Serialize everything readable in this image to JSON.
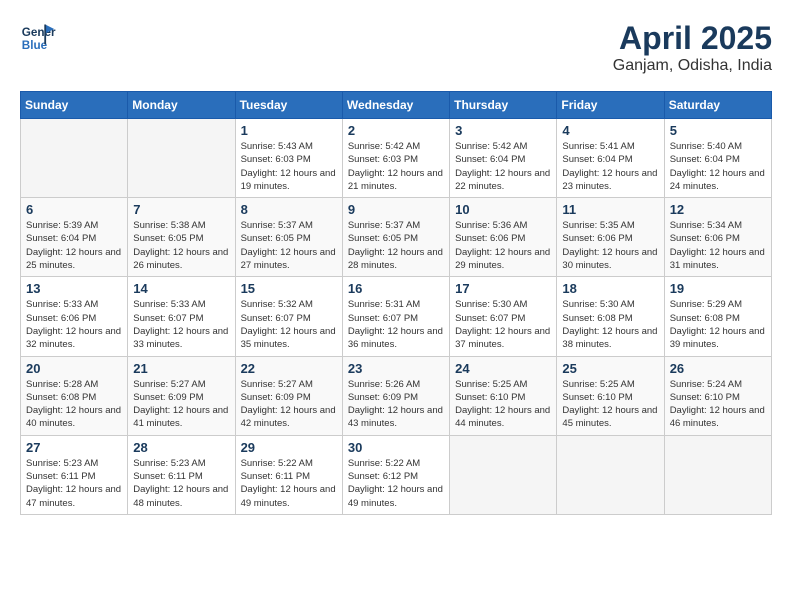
{
  "header": {
    "logo_line1": "General",
    "logo_line2": "Blue",
    "title": "April 2025",
    "location": "Ganjam, Odisha, India"
  },
  "days_of_week": [
    "Sunday",
    "Monday",
    "Tuesday",
    "Wednesday",
    "Thursday",
    "Friday",
    "Saturday"
  ],
  "weeks": [
    [
      {
        "day": "",
        "info": ""
      },
      {
        "day": "",
        "info": ""
      },
      {
        "day": "1",
        "info": "Sunrise: 5:43 AM\nSunset: 6:03 PM\nDaylight: 12 hours and 19 minutes."
      },
      {
        "day": "2",
        "info": "Sunrise: 5:42 AM\nSunset: 6:03 PM\nDaylight: 12 hours and 21 minutes."
      },
      {
        "day": "3",
        "info": "Sunrise: 5:42 AM\nSunset: 6:04 PM\nDaylight: 12 hours and 22 minutes."
      },
      {
        "day": "4",
        "info": "Sunrise: 5:41 AM\nSunset: 6:04 PM\nDaylight: 12 hours and 23 minutes."
      },
      {
        "day": "5",
        "info": "Sunrise: 5:40 AM\nSunset: 6:04 PM\nDaylight: 12 hours and 24 minutes."
      }
    ],
    [
      {
        "day": "6",
        "info": "Sunrise: 5:39 AM\nSunset: 6:04 PM\nDaylight: 12 hours and 25 minutes."
      },
      {
        "day": "7",
        "info": "Sunrise: 5:38 AM\nSunset: 6:05 PM\nDaylight: 12 hours and 26 minutes."
      },
      {
        "day": "8",
        "info": "Sunrise: 5:37 AM\nSunset: 6:05 PM\nDaylight: 12 hours and 27 minutes."
      },
      {
        "day": "9",
        "info": "Sunrise: 5:37 AM\nSunset: 6:05 PM\nDaylight: 12 hours and 28 minutes."
      },
      {
        "day": "10",
        "info": "Sunrise: 5:36 AM\nSunset: 6:06 PM\nDaylight: 12 hours and 29 minutes."
      },
      {
        "day": "11",
        "info": "Sunrise: 5:35 AM\nSunset: 6:06 PM\nDaylight: 12 hours and 30 minutes."
      },
      {
        "day": "12",
        "info": "Sunrise: 5:34 AM\nSunset: 6:06 PM\nDaylight: 12 hours and 31 minutes."
      }
    ],
    [
      {
        "day": "13",
        "info": "Sunrise: 5:33 AM\nSunset: 6:06 PM\nDaylight: 12 hours and 32 minutes."
      },
      {
        "day": "14",
        "info": "Sunrise: 5:33 AM\nSunset: 6:07 PM\nDaylight: 12 hours and 33 minutes."
      },
      {
        "day": "15",
        "info": "Sunrise: 5:32 AM\nSunset: 6:07 PM\nDaylight: 12 hours and 35 minutes."
      },
      {
        "day": "16",
        "info": "Sunrise: 5:31 AM\nSunset: 6:07 PM\nDaylight: 12 hours and 36 minutes."
      },
      {
        "day": "17",
        "info": "Sunrise: 5:30 AM\nSunset: 6:07 PM\nDaylight: 12 hours and 37 minutes."
      },
      {
        "day": "18",
        "info": "Sunrise: 5:30 AM\nSunset: 6:08 PM\nDaylight: 12 hours and 38 minutes."
      },
      {
        "day": "19",
        "info": "Sunrise: 5:29 AM\nSunset: 6:08 PM\nDaylight: 12 hours and 39 minutes."
      }
    ],
    [
      {
        "day": "20",
        "info": "Sunrise: 5:28 AM\nSunset: 6:08 PM\nDaylight: 12 hours and 40 minutes."
      },
      {
        "day": "21",
        "info": "Sunrise: 5:27 AM\nSunset: 6:09 PM\nDaylight: 12 hours and 41 minutes."
      },
      {
        "day": "22",
        "info": "Sunrise: 5:27 AM\nSunset: 6:09 PM\nDaylight: 12 hours and 42 minutes."
      },
      {
        "day": "23",
        "info": "Sunrise: 5:26 AM\nSunset: 6:09 PM\nDaylight: 12 hours and 43 minutes."
      },
      {
        "day": "24",
        "info": "Sunrise: 5:25 AM\nSunset: 6:10 PM\nDaylight: 12 hours and 44 minutes."
      },
      {
        "day": "25",
        "info": "Sunrise: 5:25 AM\nSunset: 6:10 PM\nDaylight: 12 hours and 45 minutes."
      },
      {
        "day": "26",
        "info": "Sunrise: 5:24 AM\nSunset: 6:10 PM\nDaylight: 12 hours and 46 minutes."
      }
    ],
    [
      {
        "day": "27",
        "info": "Sunrise: 5:23 AM\nSunset: 6:11 PM\nDaylight: 12 hours and 47 minutes."
      },
      {
        "day": "28",
        "info": "Sunrise: 5:23 AM\nSunset: 6:11 PM\nDaylight: 12 hours and 48 minutes."
      },
      {
        "day": "29",
        "info": "Sunrise: 5:22 AM\nSunset: 6:11 PM\nDaylight: 12 hours and 49 minutes."
      },
      {
        "day": "30",
        "info": "Sunrise: 5:22 AM\nSunset: 6:12 PM\nDaylight: 12 hours and 49 minutes."
      },
      {
        "day": "",
        "info": ""
      },
      {
        "day": "",
        "info": ""
      },
      {
        "day": "",
        "info": ""
      }
    ]
  ]
}
